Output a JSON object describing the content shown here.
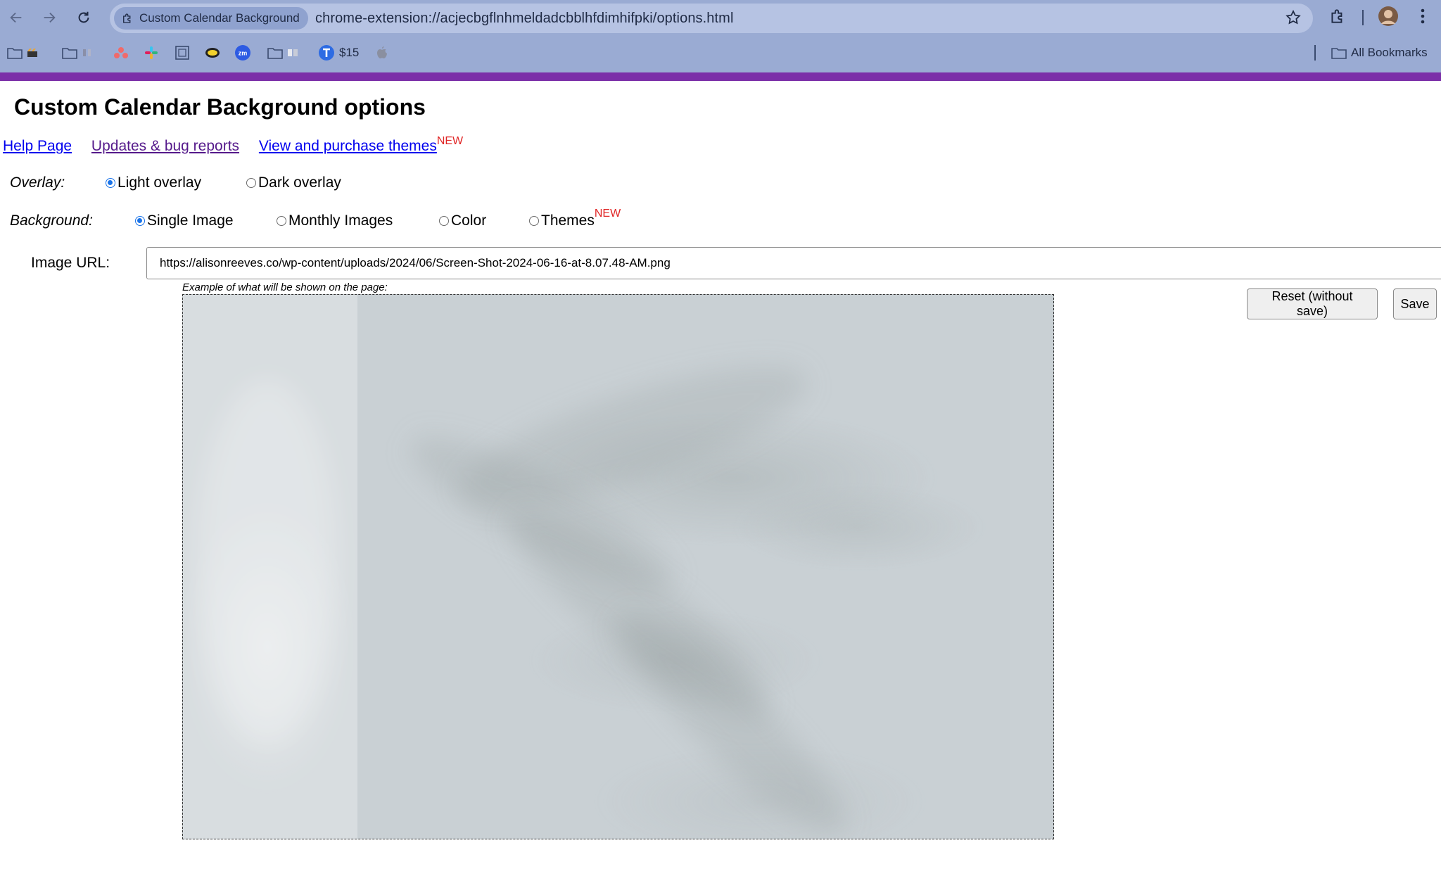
{
  "browser": {
    "tab_chip_label": "Custom Calendar Background",
    "url": "chrome-extension://acjecbgflnhmeldadcbblhfdimhifpki/options.html",
    "bookmarks": {
      "price": "$15",
      "all_bookmarks": "All Bookmarks"
    }
  },
  "page": {
    "title": "Custom Calendar Background options",
    "links": {
      "help": "Help Page",
      "updates": "Updates & bug reports",
      "themes": "View and purchase themes",
      "new_badge": "NEW"
    },
    "overlay": {
      "label": "Overlay:",
      "options": [
        "Light overlay",
        "Dark overlay"
      ],
      "selected": "Light overlay"
    },
    "background": {
      "label": "Background:",
      "options": [
        "Single Image",
        "Monthly Images",
        "Color",
        "Themes"
      ],
      "selected": "Single Image",
      "new_badge": "NEW"
    },
    "image_url": {
      "label": "Image URL:",
      "value": "https://alisonreeves.co/wp-content/uploads/2024/06/Screen-Shot-2024-06-16-at-8.07.48-AM.png"
    },
    "preview_caption": "Example of what will be shown on the page:",
    "buttons": {
      "reset": "Reset (without save)",
      "save": "Save"
    }
  },
  "colors": {
    "accent_bar": "#7b2fa8",
    "chrome_bg": "#9aabd3",
    "link": "#0000ee",
    "visited_link": "#551a8b",
    "new_badge": "#e02424",
    "radio_selected": "#1a73e8"
  }
}
